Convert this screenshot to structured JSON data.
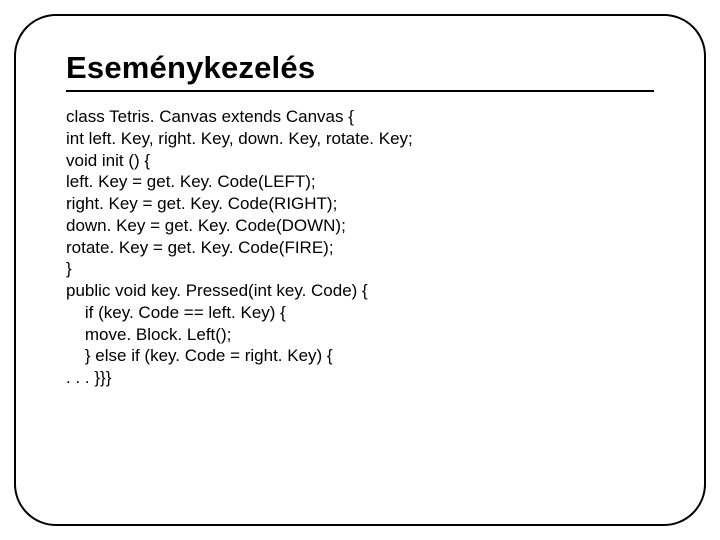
{
  "title": "Eseménykezelés",
  "code_lines": [
    "class Tetris. Canvas extends Canvas {",
    "int left. Key, right. Key, down. Key, rotate. Key;",
    "void init () {",
    "left. Key = get. Key. Code(LEFT);",
    "right. Key = get. Key. Code(RIGHT);",
    "down. Key = get. Key. Code(DOWN);",
    "rotate. Key = get. Key. Code(FIRE);",
    "}",
    "public void key. Pressed(int key. Code) {",
    "    if (key. Code == left. Key) {",
    "    move. Block. Left();",
    "    } else if (key. Code = right. Key) {",
    ". . . }}}"
  ]
}
